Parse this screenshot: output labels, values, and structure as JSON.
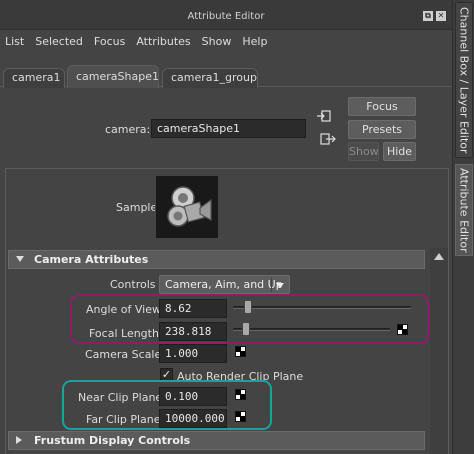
{
  "window": {
    "title": "Attribute Editor",
    "controls": [
      "⧉",
      "✕"
    ]
  },
  "menubar": [
    "List",
    "Selected",
    "Focus",
    "Attributes",
    "Show",
    "Help"
  ],
  "tabs": [
    {
      "label": "camera1"
    },
    {
      "label": "cameraShape1"
    },
    {
      "label": "camera1_group"
    }
  ],
  "active_tab": "cameraShape1",
  "node": {
    "label": "camera:",
    "value": "cameraShape1"
  },
  "buttons": {
    "focus": "Focus",
    "presets": "Presets",
    "show": "Show",
    "hide": "Hide"
  },
  "sample": {
    "label": "Sample"
  },
  "side_tabs": {
    "channel_box": "Channel Box / Layer Editor",
    "attribute_editor": "Attribute Editor"
  },
  "sections": {
    "camera_attributes": {
      "title": "Camera Attributes",
      "expanded": true,
      "controls": {
        "label": "Controls",
        "value": "Camera, Aim, and Up"
      },
      "angle_of_view": {
        "label": "Angle of View",
        "value": "8.62",
        "slider_fraction": 0.05
      },
      "focal_length": {
        "label": "Focal Length",
        "value": "238.818",
        "slider_fraction": 0.04
      },
      "camera_scale": {
        "label": "Camera Scale",
        "value": "1.000"
      },
      "auto_render_clip_plane": {
        "label": "Auto Render Clip Plane",
        "checked": true
      },
      "near_clip_plane": {
        "label": "Near Clip Plane",
        "value": "0.100"
      },
      "far_clip_plane": {
        "label": "Far Clip Plane",
        "value": "10000.000"
      }
    },
    "frustum_display_controls": {
      "title": "Frustum Display Controls",
      "expanded": false
    }
  },
  "colors": {
    "highlight_purple": "#8a1e6c",
    "highlight_teal": "#1ca0a0"
  }
}
